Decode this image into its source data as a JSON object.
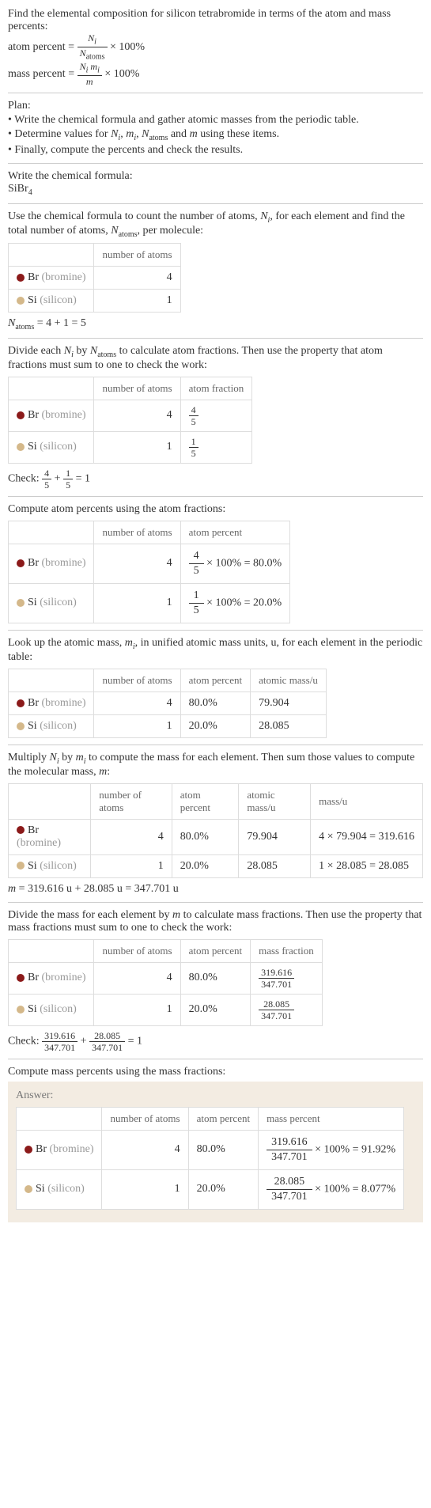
{
  "intro": {
    "line1": "Find the elemental composition for silicon tetrabromide in terms of the atom and mass percents:",
    "atom_percent_label": "atom percent = ",
    "atom_percent_frac_num": "N_i",
    "atom_percent_frac_den": "N_atoms",
    "times100": " × 100%",
    "mass_percent_label": "mass percent = ",
    "mass_percent_frac_num": "N_i m_i",
    "mass_percent_frac_den": "m"
  },
  "plan": {
    "title": "Plan:",
    "l1": "• Write the chemical formula and gather atomic masses from the periodic table.",
    "l2_a": "• Determine values for ",
    "l2_b": " using these items.",
    "l3": "• Finally, compute the percents and check the results."
  },
  "step_formula": {
    "title": "Write the chemical formula:",
    "formula": "SiBr",
    "sub": "4"
  },
  "step_count": {
    "intro_a": "Use the chemical formula to count the number of atoms, ",
    "intro_b": ", for each element and find the total number of atoms, ",
    "intro_c": ", per molecule:",
    "col_atoms": "number of atoms",
    "br_label": "Br",
    "br_note": "(bromine)",
    "br_n": "4",
    "si_label": "Si",
    "si_note": "(silicon)",
    "si_n": "1",
    "total": " = 4 + 1 = 5"
  },
  "step_atomfrac": {
    "intro_a": "Divide each ",
    "intro_b": " by ",
    "intro_c": " to calculate atom fractions. Then use the property that atom fractions must sum to one to check the work:",
    "col_atoms": "number of atoms",
    "col_frac": "atom fraction",
    "br_n": "4",
    "br_frac_num": "4",
    "br_frac_den": "5",
    "si_n": "1",
    "si_frac_num": "1",
    "si_frac_den": "5",
    "check_label": "Check: ",
    "check_eq": " = 1"
  },
  "step_atompct": {
    "intro": "Compute atom percents using the atom fractions:",
    "col_atoms": "number of atoms",
    "col_pct": "atom percent",
    "br_n": "4",
    "br_calc": " × 100% = 80.0%",
    "si_n": "1",
    "si_calc": " × 100% = 20.0%"
  },
  "step_mass_lookup": {
    "intro_a": "Look up the atomic mass, ",
    "intro_b": ", in unified atomic mass units, u, for each element in the periodic table:",
    "col_atoms": "number of atoms",
    "col_pct": "atom percent",
    "col_mass": "atomic mass/u",
    "br_n": "4",
    "br_pct": "80.0%",
    "br_mass": "79.904",
    "si_n": "1",
    "si_pct": "20.0%",
    "si_mass": "28.085"
  },
  "step_mass_calc": {
    "intro_a": "Multiply ",
    "intro_b": " by ",
    "intro_c": " to compute the mass for each element. Then sum those values to compute the molecular mass, ",
    "intro_d": ":",
    "col_atoms": "number of atoms",
    "col_pct": "atom percent",
    "col_amass": "atomic mass/u",
    "col_mass": "mass/u",
    "br_n": "4",
    "br_pct": "80.0%",
    "br_amass": "79.904",
    "br_calc": "4 × 79.904 = 319.616",
    "si_n": "1",
    "si_pct": "20.0%",
    "si_amass": "28.085",
    "si_calc": "1 × 28.085 = 28.085",
    "total": " = 319.616 u + 28.085 u = 347.701 u"
  },
  "step_massfrac": {
    "intro": "Divide the mass for each element by m to calculate mass fractions. Then use the property that mass fractions must sum to one to check the work:",
    "col_atoms": "number of atoms",
    "col_pct": "atom percent",
    "col_frac": "mass fraction",
    "br_n": "4",
    "br_pct": "80.0%",
    "br_num": "319.616",
    "br_den": "347.701",
    "si_n": "1",
    "si_pct": "20.0%",
    "si_num": "28.085",
    "si_den": "347.701",
    "check_label": "Check: ",
    "check_eq": " = 1"
  },
  "step_masspct": {
    "intro": "Compute mass percents using the mass fractions:"
  },
  "answer": {
    "title": "Answer:",
    "col_atoms": "number of atoms",
    "col_apct": "atom percent",
    "col_mpct": "mass percent",
    "br_n": "4",
    "br_apct": "80.0%",
    "br_num": "319.616",
    "br_den": "347.701",
    "br_res": " × 100% = 91.92%",
    "si_n": "1",
    "si_apct": "20.0%",
    "si_num": "28.085",
    "si_den": "347.701",
    "si_res": " × 100% = 8.077%"
  },
  "elements": {
    "br": "Br",
    "br_note": "(bromine)",
    "si": "Si",
    "si_note": "(silicon)"
  },
  "chart_data": {
    "type": "table",
    "title": "Elemental composition of SiBr4",
    "series": [
      {
        "element": "Br",
        "number_of_atoms": 4,
        "atom_fraction": 0.8,
        "atom_percent": 80.0,
        "atomic_mass_u": 79.904,
        "mass_u": 319.616,
        "mass_fraction": 0.9192,
        "mass_percent": 91.92
      },
      {
        "element": "Si",
        "number_of_atoms": 1,
        "atom_fraction": 0.2,
        "atom_percent": 20.0,
        "atomic_mass_u": 28.085,
        "mass_u": 28.085,
        "mass_fraction": 0.08077,
        "mass_percent": 8.077
      }
    ],
    "N_atoms": 5,
    "molecular_mass_u": 347.701
  }
}
